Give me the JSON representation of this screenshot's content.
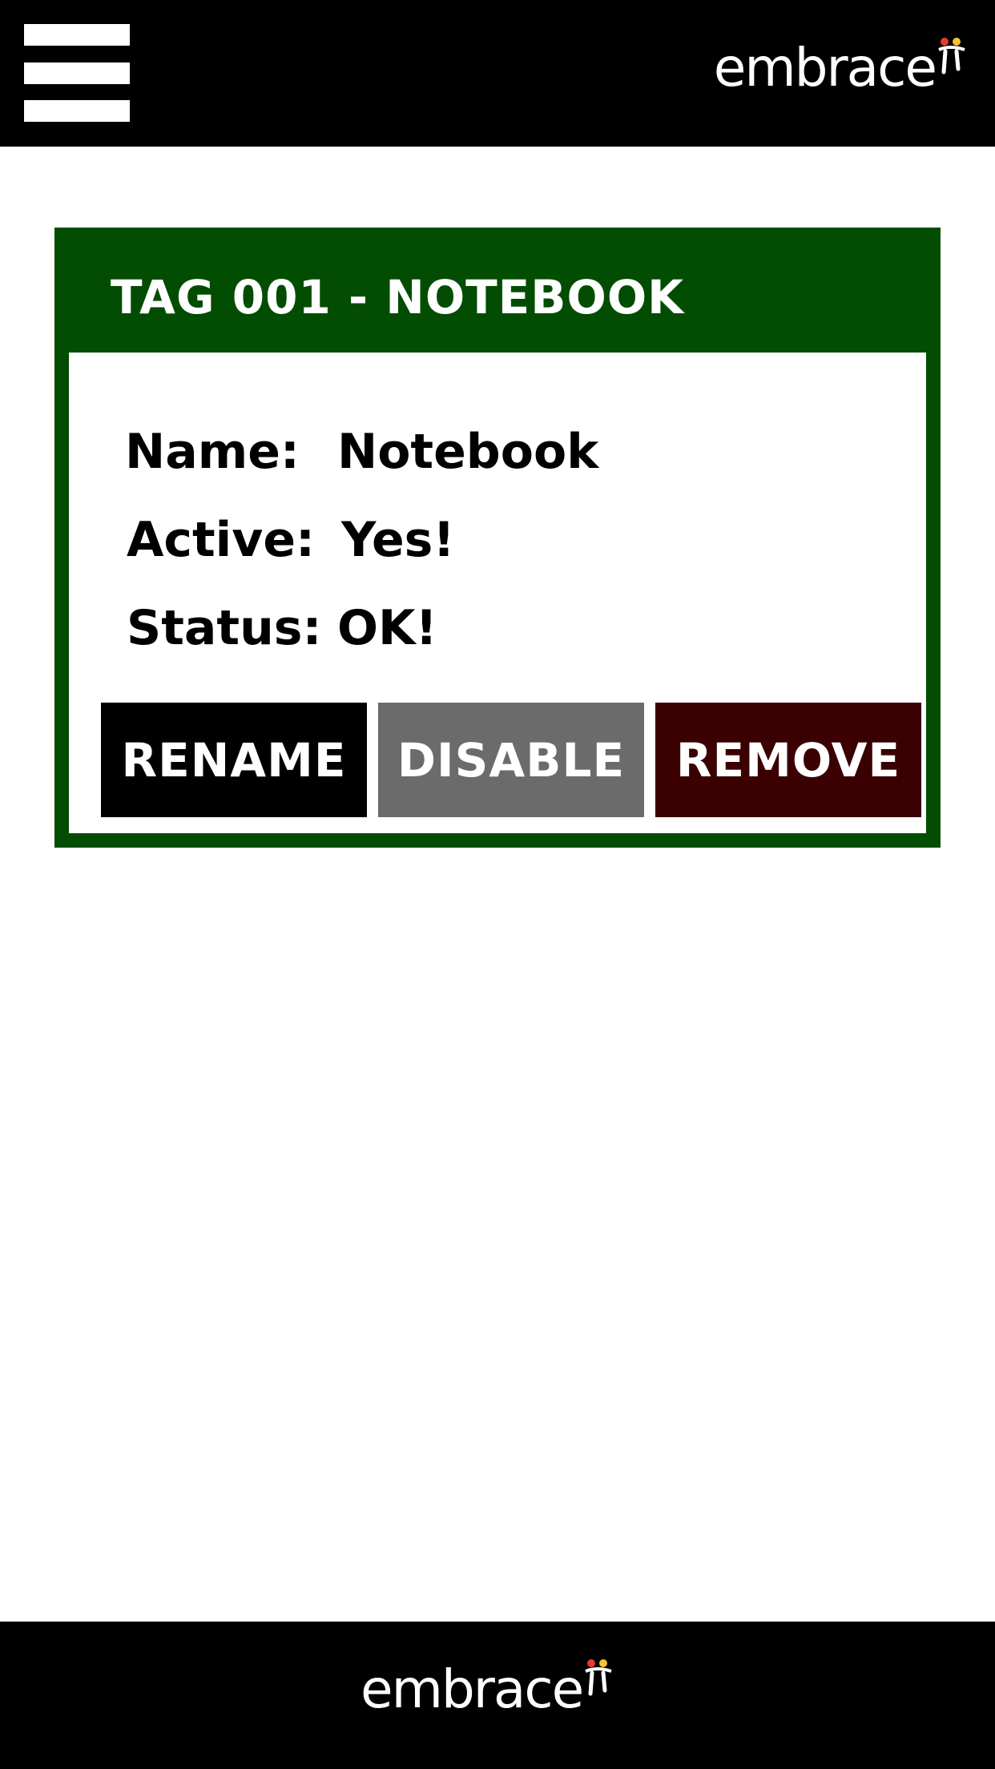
{
  "header": {
    "menu_icon": "hamburger-menu-icon",
    "logo_text": "embrace",
    "logo_mark_icon": "embrace-figures-mark"
  },
  "card": {
    "title": "TAG 001 - NOTEBOOK",
    "fields": [
      {
        "label": "Name:",
        "value": "Notebook"
      },
      {
        "label": "Active:",
        "value": "Yes!"
      },
      {
        "label": "Status:",
        "value": "OK!"
      }
    ],
    "buttons": {
      "rename": "RENAME",
      "disable": "DISABLE",
      "remove": "REMOVE"
    }
  },
  "footer": {
    "logo_text": "embrace"
  },
  "colors": {
    "bar": "#000000",
    "card_green": "#034d02",
    "rename_bg": "#000000",
    "disable_bg": "#6b6b6b",
    "remove_bg": "#3a0002",
    "logo_dot_red": "#e63b2e",
    "logo_dot_yellow": "#f2c230"
  }
}
